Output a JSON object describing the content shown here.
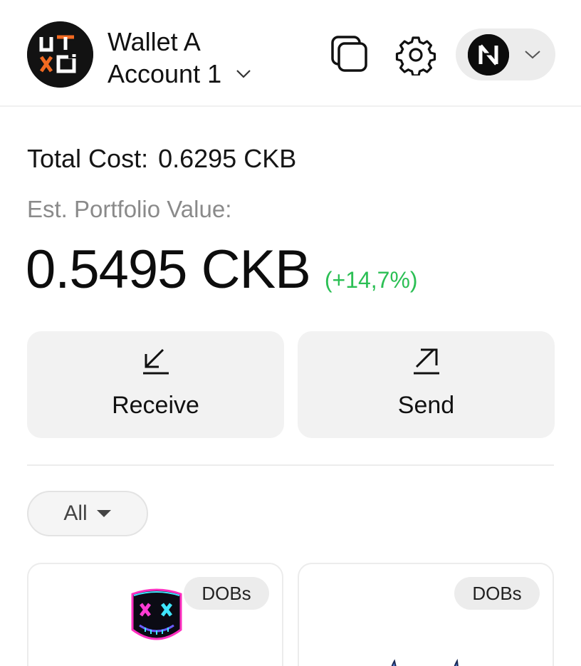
{
  "header": {
    "wallet_name": "Wallet A",
    "account_name": "Account 1",
    "logo_text_top": "UT",
    "logo_text_bottom": "XO",
    "icons": {
      "logo": "utxo-logo-icon",
      "account_dropdown": "chevron-down-icon",
      "copy": "copy-icon",
      "settings": "gear-icon",
      "network": "nervos-network-icon",
      "network_dropdown": "chevron-down-icon"
    }
  },
  "summary": {
    "total_cost_label": "Total Cost:",
    "total_cost_value": "0.6295 CKB",
    "est_label": "Est. Portfolio Value:",
    "portfolio_value": "0.5495 CKB",
    "portfolio_change": "(+14,7%)",
    "change_color": "#2bbf54"
  },
  "actions": {
    "receive_label": "Receive",
    "send_label": "Send",
    "receive_icon": "arrow-down-left-icon",
    "send_icon": "arrow-up-right-icon"
  },
  "filter": {
    "selected": "All",
    "icon": "caret-down-icon"
  },
  "assets": [
    {
      "badge": "DOBs",
      "image": "neon-mask-image"
    },
    {
      "badge": "DOBs",
      "image": "blue-horns-image"
    }
  ],
  "colors": {
    "accent_orange": "#f26a21",
    "logo_bg": "#121212",
    "button_bg": "#f2f2f2",
    "positive": "#2bbf54"
  }
}
